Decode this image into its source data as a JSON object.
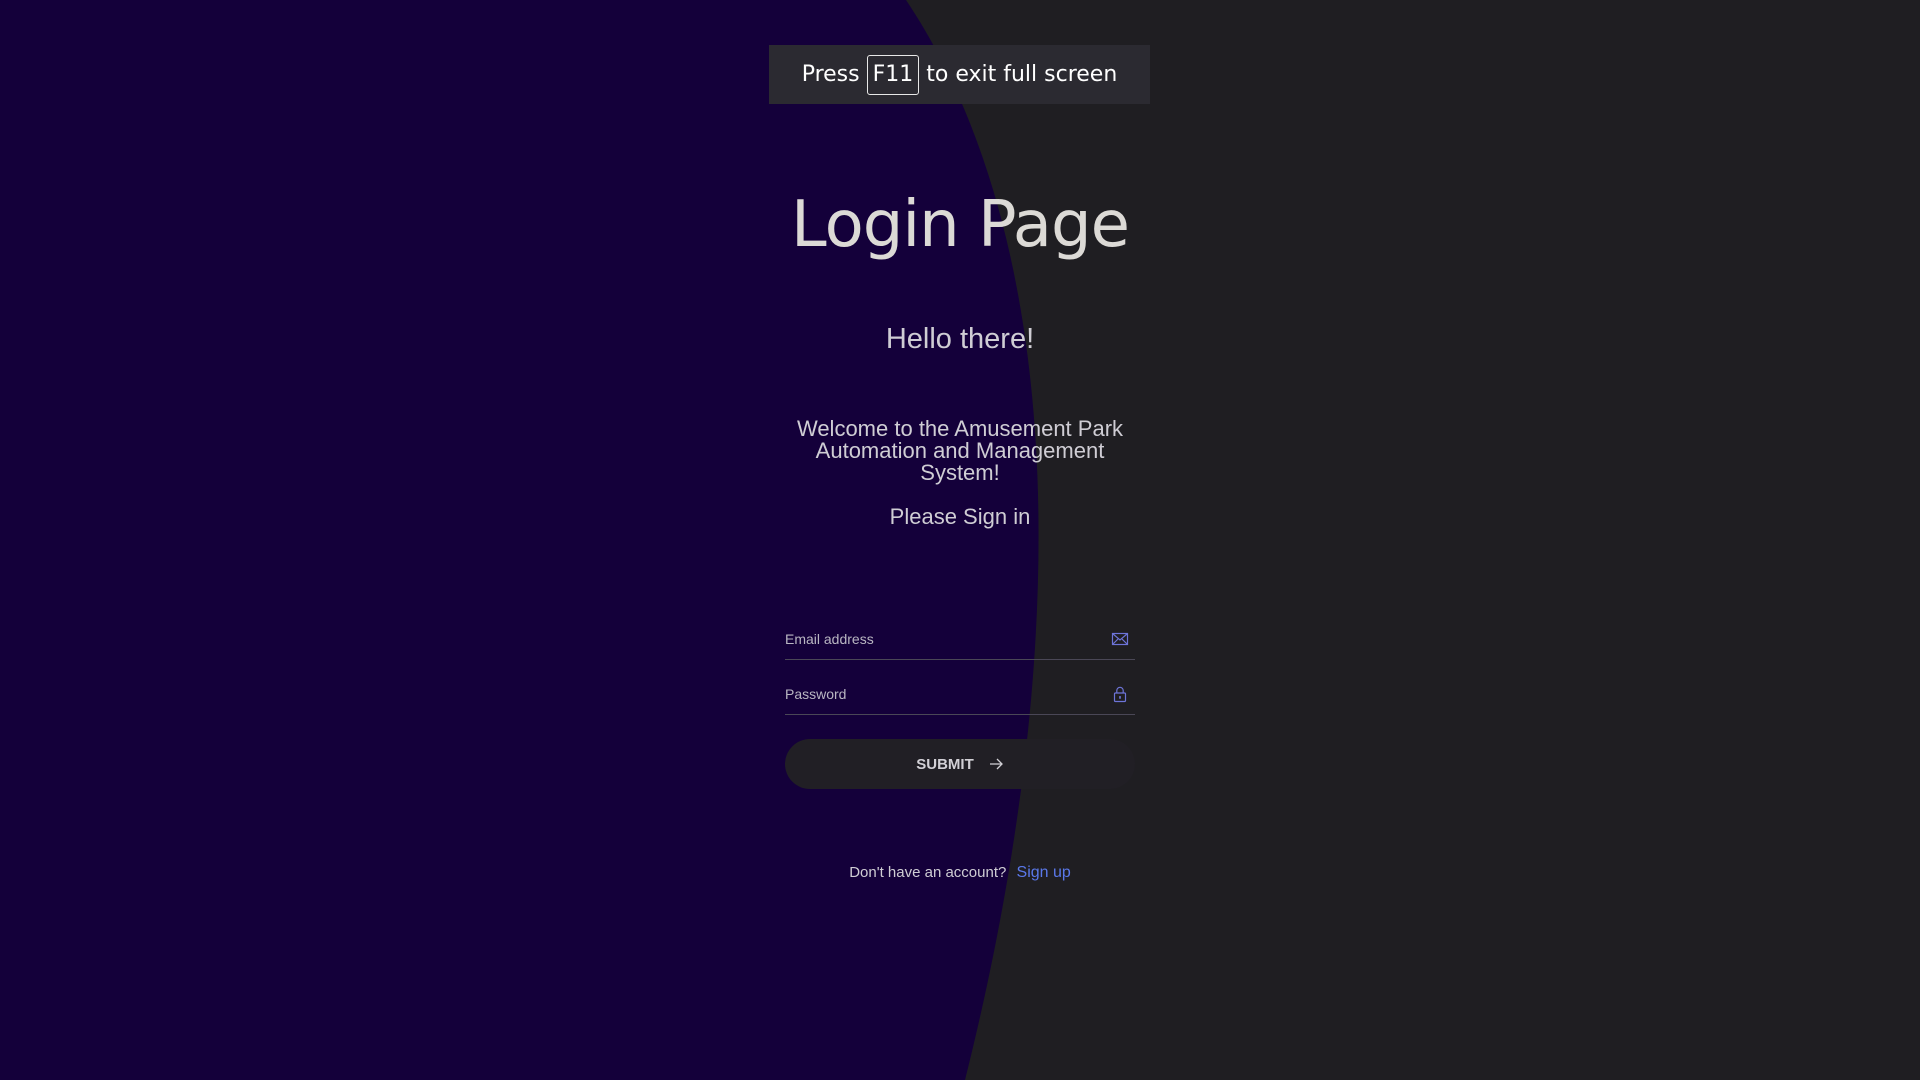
{
  "fullscreen_notice": {
    "prefix": "Press",
    "key": "F11",
    "suffix": "to exit full screen"
  },
  "page": {
    "title": "Login Page",
    "greeting": "Hello there!",
    "welcome": "Welcome to the Amusement Park Automation and Management System!",
    "instruction": "Please Sign in"
  },
  "form": {
    "email_placeholder": "Email address",
    "email_icon": "envelope-icon",
    "password_placeholder": "Password",
    "password_icon": "lock-icon",
    "submit_label": "SUBMIT",
    "submit_icon": "arrow-right-icon"
  },
  "footer": {
    "prompt": "Don't have an account?",
    "signup_link": "Sign up"
  },
  "colors": {
    "left_panel": "#14003a",
    "right_panel": "#1f1e22",
    "link": "#5a78ea",
    "icon_accent": "#6d74d8"
  }
}
